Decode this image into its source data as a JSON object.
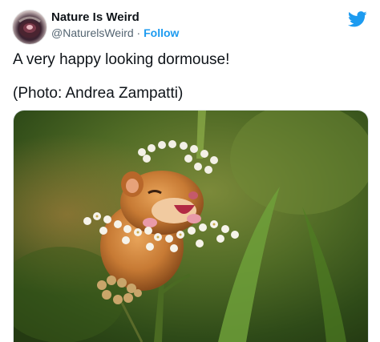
{
  "author": {
    "display_name": "Nature Is Weird",
    "handle": "@NaturelsWeird",
    "separator": "·",
    "follow_label": "Follow"
  },
  "tweet": {
    "line1": "A very happy looking dormouse!",
    "line2": "(Photo: Andrea Zampatti)"
  },
  "icons": {
    "brand": "twitter-bird-icon"
  },
  "colors": {
    "follow": "#1d9bf0",
    "handle": "#536471",
    "text": "#0f1419"
  }
}
